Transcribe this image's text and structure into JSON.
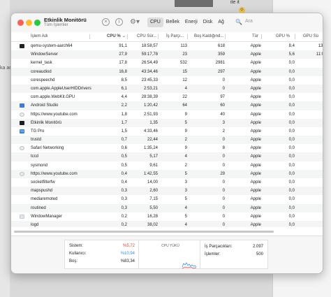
{
  "window": {
    "title": "Etkinlik Monitörü",
    "subtitle": "Tüm İşlemler",
    "tabs": [
      "CPU",
      "Bellek",
      "Enerji",
      "Disk",
      "Ağ"
    ],
    "active_tab": "CPU",
    "search_placeholder": "Ara"
  },
  "columns": [
    "İşlem Adı",
    "CPU %",
    "CPU Sür...",
    "İş Parçı...",
    "Boş Kaldığınd...",
    "Tür",
    "GPU %",
    "GPU Sü"
  ],
  "rows": [
    {
      "icon": "terminal-icon",
      "name": "qemu-system-aarch64",
      "cpu": "91,1",
      "time": "18:58,57",
      "threads": "113",
      "idle": "618",
      "user": "Apple",
      "gpu": "8,4",
      "gput": "13:"
    },
    {
      "icon": "none",
      "name": "WindowServer",
      "cpu": "27,9",
      "time": "59:17,78",
      "threads": "23",
      "idle": "359",
      "user": "Apple",
      "gpu": "5,6",
      "gput": "11:0"
    },
    {
      "icon": "none",
      "name": "kernel_task",
      "cpu": "17,8",
      "time": "26:54,49",
      "threads": "532",
      "idle": "2981",
      "user": "Apple",
      "gpu": "0,0",
      "gput": ""
    },
    {
      "icon": "none",
      "name": "coreaudiod",
      "cpu": "16,8",
      "time": "43:34,46",
      "threads": "15",
      "idle": "297",
      "user": "Apple",
      "gpu": "0,0",
      "gput": ""
    },
    {
      "icon": "none",
      "name": "corespeechd",
      "cpu": "8,5",
      "time": "23:45,33",
      "threads": "12",
      "idle": "0",
      "user": "Apple",
      "gpu": "0,0",
      "gput": ""
    },
    {
      "icon": "none",
      "name": "com.apple.AppleUserHIDDrivers",
      "cpu": "6,1",
      "time": "2:53,21",
      "threads": "4",
      "idle": "0",
      "user": "Apple",
      "gpu": "0,0",
      "gput": ""
    },
    {
      "icon": "none",
      "name": "com.apple.WebKit.GPU",
      "cpu": "4,4",
      "time": "28:38,39",
      "threads": "22",
      "idle": "97",
      "user": "Apple",
      "gpu": "0,0",
      "gput": ""
    },
    {
      "icon": "android-studio-icon",
      "name": "Android Studio",
      "cpu": "2,2",
      "time": "1:20,42",
      "threads": "64",
      "idle": "60",
      "user": "Apple",
      "gpu": "0,0",
      "gput": ""
    },
    {
      "icon": "shield-icon",
      "name": "https://www.youtube.com",
      "cpu": "1,8",
      "time": "2:51,93",
      "threads": "9",
      "idle": "40",
      "user": "Apple",
      "gpu": "0,0",
      "gput": ""
    },
    {
      "icon": "activity-monitor-icon",
      "name": "Etkinlik Monitörü",
      "cpu": "1,7",
      "time": "1,35",
      "threads": "5",
      "idle": "3",
      "user": "Apple",
      "gpu": "0,0",
      "gput": ""
    },
    {
      "icon": "tg-pro-icon",
      "name": "TG Pro",
      "cpu": "1,5",
      "time": "4:33,46",
      "threads": "9",
      "idle": "2",
      "user": "Apple",
      "gpu": "0,0",
      "gput": ""
    },
    {
      "icon": "none",
      "name": "trustd",
      "cpu": "0,7",
      "time": "22,44",
      "threads": "2",
      "idle": "0",
      "user": "Apple",
      "gpu": "0,0",
      "gput": ""
    },
    {
      "icon": "shield-icon",
      "name": "Safari Networking",
      "cpu": "0,6",
      "time": "1:35,24",
      "threads": "9",
      "idle": "8",
      "user": "Apple",
      "gpu": "0,0",
      "gput": ""
    },
    {
      "icon": "none",
      "name": "tccd",
      "cpu": "0,5",
      "time": "5,17",
      "threads": "4",
      "idle": "0",
      "user": "Apple",
      "gpu": "0,0",
      "gput": ""
    },
    {
      "icon": "none",
      "name": "sysmond",
      "cpu": "0,5",
      "time": "9,61",
      "threads": "2",
      "idle": "0",
      "user": "Apple",
      "gpu": "0,0",
      "gput": ""
    },
    {
      "icon": "shield-icon",
      "name": "https://www.youtube.com",
      "cpu": "0,4",
      "time": "1:42,55",
      "threads": "5",
      "idle": "29",
      "user": "Apple",
      "gpu": "0,0",
      "gput": ""
    },
    {
      "icon": "none",
      "name": "socketfilterfw",
      "cpu": "0,4",
      "time": "14,00",
      "threads": "3",
      "idle": "0",
      "user": "Apple",
      "gpu": "0,0",
      "gput": ""
    },
    {
      "icon": "none",
      "name": "mapspushd",
      "cpu": "0,3",
      "time": "2,60",
      "threads": "3",
      "idle": "0",
      "user": "Apple",
      "gpu": "0,0",
      "gput": ""
    },
    {
      "icon": "none",
      "name": "mediaremoted",
      "cpu": "0,3",
      "time": "7,15",
      "threads": "5",
      "idle": "0",
      "user": "Apple",
      "gpu": "0,0",
      "gput": ""
    },
    {
      "icon": "none",
      "name": "routined",
      "cpu": "0,3",
      "time": "5,50",
      "threads": "4",
      "idle": "0",
      "user": "Apple",
      "gpu": "0,0",
      "gput": ""
    },
    {
      "icon": "doc-icon",
      "name": "WindowManager",
      "cpu": "0,2",
      "time": "16,28",
      "threads": "5",
      "idle": "0",
      "user": "Apple",
      "gpu": "0,0",
      "gput": ""
    },
    {
      "icon": "none",
      "name": "logd",
      "cpu": "0,2",
      "time": "38,02",
      "threads": "4",
      "idle": "0",
      "user": "Apple",
      "gpu": "0,0",
      "gput": ""
    }
  ],
  "summary": {
    "system_label": "Sistem:",
    "system_value": "%5,72",
    "system_color": "#e0443a",
    "user_label": "Kullanıcı:",
    "user_value": "%10,94",
    "user_color": "#3d8ef0",
    "idle_label": "Boş:",
    "idle_value": "%83,34",
    "load_title": "CPU YÜKÜ",
    "threads_label": "İş Parçacıkları:",
    "threads_value": "2.097",
    "processes_label": "İşlemler:",
    "processes_value": "500"
  }
}
